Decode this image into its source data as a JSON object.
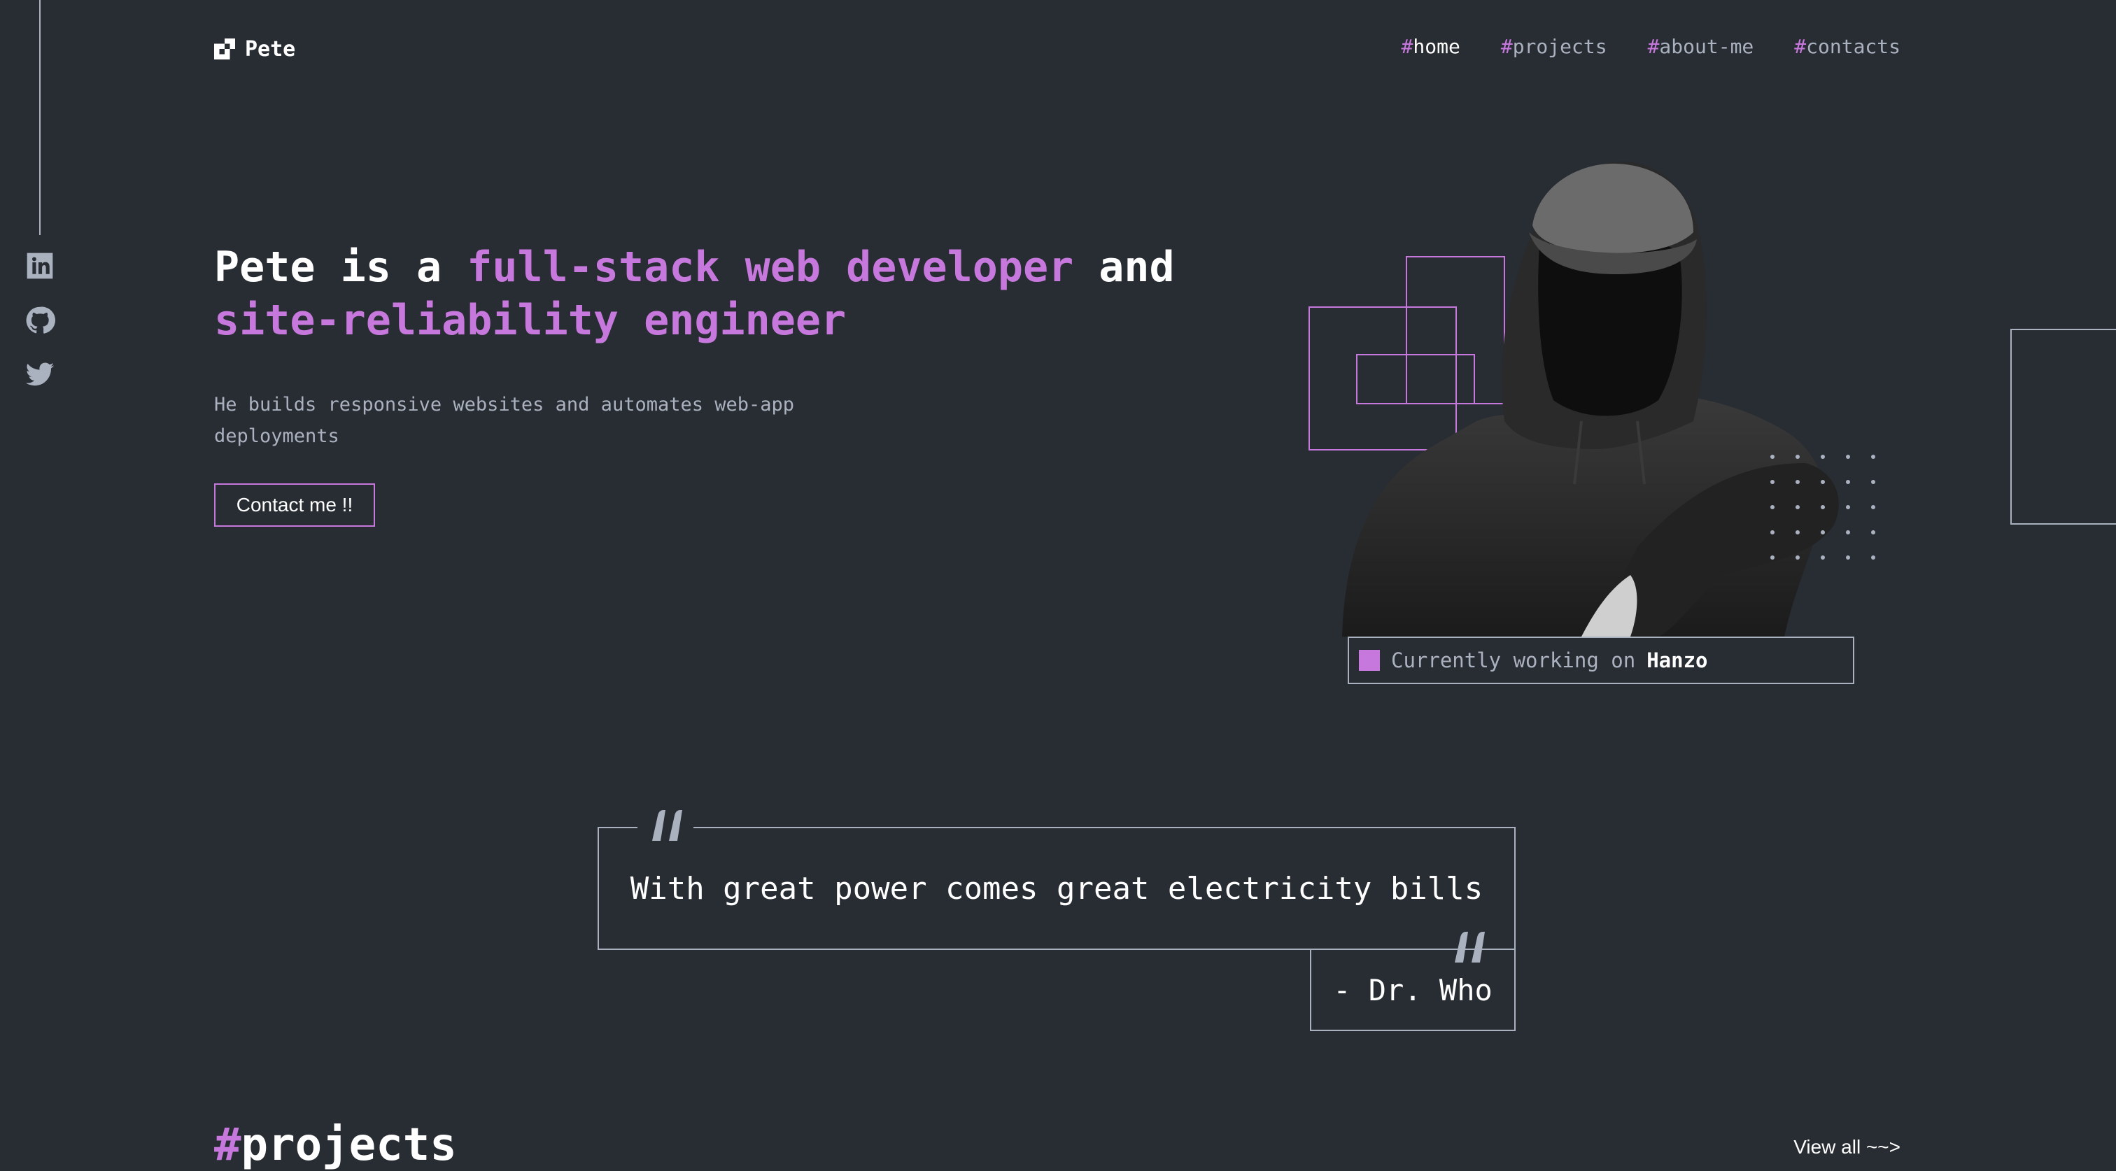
{
  "header": {
    "logo_text": "Pete",
    "nav": [
      {
        "hash": "#",
        "label": "home",
        "active": true
      },
      {
        "hash": "#",
        "label": "projects",
        "active": false
      },
      {
        "hash": "#",
        "label": "about-me",
        "active": false
      },
      {
        "hash": "#",
        "label": "contacts",
        "active": false
      }
    ]
  },
  "social": [
    {
      "icon": "linkedin-icon"
    },
    {
      "icon": "github-icon"
    },
    {
      "icon": "twitter-icon"
    }
  ],
  "hero": {
    "headline_part1": "Pete is a ",
    "headline_accent1": "full-stack web developer",
    "headline_part2": " and",
    "headline_accent2": "site-reliability engineer",
    "subtext": "He builds responsive websites and automates web-app deployments",
    "cta_label": "Contact me !!",
    "status_prefix": "Currently working on",
    "status_project": "Hanzo"
  },
  "quote": {
    "text": "With great power comes great electricity bills",
    "author": "- Dr. Who"
  },
  "projects": {
    "hash": "#",
    "title": "projects",
    "view_all": "View all ~~>"
  },
  "colors": {
    "background": "#282c33",
    "accent": "#c778dd",
    "text_muted": "#abb2bf",
    "text_bright": "#ffffff"
  }
}
